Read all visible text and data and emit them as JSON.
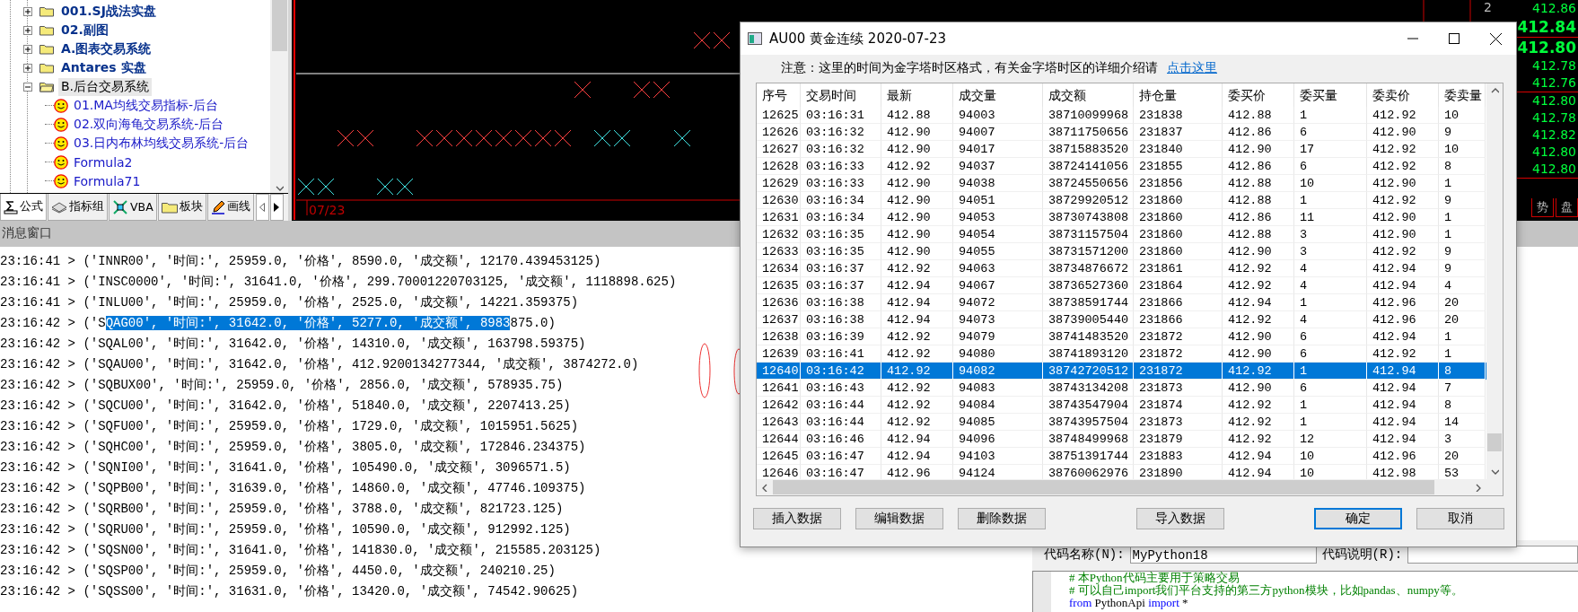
{
  "tree": {
    "items": [
      {
        "label": "001.SJ战法实盘",
        "kind": "folder",
        "expanded": false,
        "selected": false
      },
      {
        "label": "02.副图",
        "kind": "folder",
        "expanded": false,
        "selected": false
      },
      {
        "label": "A.图表交易系统",
        "kind": "folder",
        "expanded": false,
        "selected": false
      },
      {
        "label": "Antares 实盘",
        "kind": "folder",
        "expanded": false,
        "selected": false
      },
      {
        "label": "B.后台交易系统",
        "kind": "folder",
        "expanded": true,
        "selected": true,
        "children": [
          {
            "label": "01.MA均线交易指标-后台",
            "kind": "formula",
            "selected": false
          },
          {
            "label": "02.双向海龟交易系统-后台",
            "kind": "formula",
            "selected": false
          },
          {
            "label": "03.日内布林均线交易系统-后台",
            "kind": "formula",
            "selected": false
          },
          {
            "label": "Formula2",
            "kind": "formula",
            "selected": false
          },
          {
            "label": "Formula71",
            "kind": "formula",
            "selected": false
          }
        ]
      }
    ]
  },
  "panel_tabs": [
    {
      "label": "公式",
      "kind": "formula",
      "selected": true
    },
    {
      "label": "指标组",
      "kind": "group",
      "selected": false
    },
    {
      "label": "VBA",
      "kind": "vba",
      "selected": false
    },
    {
      "label": "板块",
      "kind": "folder",
      "selected": false
    },
    {
      "label": "画线",
      "kind": "pen",
      "selected": false
    }
  ],
  "chart": {
    "date": "07/23",
    "corner_label": "2"
  },
  "ticker": {
    "groups": [
      {
        "prices": [
          {
            "text": "412.86",
            "emphasis": false
          },
          {
            "text": "412.84",
            "emphasis": true
          }
        ]
      },
      {
        "prices": [
          {
            "text": "412.80",
            "emphasis": true
          },
          {
            "text": "412.78",
            "emphasis": false
          },
          {
            "text": "412.76",
            "emphasis": false
          }
        ]
      },
      {
        "prices": [
          {
            "text": "412.80",
            "emphasis": false
          },
          {
            "text": "412.78",
            "emphasis": false
          },
          {
            "text": "412.82",
            "emphasis": false
          },
          {
            "text": "412.80",
            "emphasis": false
          },
          {
            "text": "412.80",
            "emphasis": false
          }
        ]
      }
    ],
    "tabs": [
      {
        "label": "势",
        "selected": false
      },
      {
        "label": "盘",
        "selected": false
      }
    ]
  },
  "message_window": {
    "title": "消息窗口",
    "lines": [
      {
        "parts": [
          {
            "text": "23:16:41 > ('INNR00', '时间:', 25959.0, '价格', 8590.0, '成交额', 12170.439453125)",
            "selected": false
          }
        ]
      },
      {
        "parts": [
          {
            "text": "23:16:41 > ('INSC0000', '时间:', 31641.0, '价格', 299.70001220703125, '成交额', 1118898.625)",
            "selected": false
          }
        ]
      },
      {
        "parts": [
          {
            "text": "23:16:41 > ('INLU00', '时间:', 25959.0, '价格', 2525.0, '成交额', 14221.359375)",
            "selected": false
          }
        ]
      },
      {
        "parts": [
          {
            "text": "23:16:42 > ('S",
            "selected": false
          },
          {
            "text": "QAG00', '时间:', 31642.0, '价格', 5277.0, '成交额', 8983",
            "selected": true
          },
          {
            "text": "875.0)",
            "selected": false
          }
        ]
      },
      {
        "parts": [
          {
            "text": "23:16:42 > ('SQAL00', '时间:', 31642.0, '价格', 14310.0, '成交额', 163798.59375)",
            "selected": false
          }
        ]
      },
      {
        "parts": [
          {
            "text": "23:16:42 > ('SQAU00', '时间:', 31642.0, '价格', 412.9200134277344, '成交额', 3874272.0)",
            "selected": false
          }
        ]
      },
      {
        "parts": [
          {
            "text": "23:16:42 > ('SQBUX00', '时间:', 25959.0, '价格', 2856.0, '成交额', 578935.75)",
            "selected": false
          }
        ]
      },
      {
        "parts": [
          {
            "text": "23:16:42 > ('SQCU00', '时间:', 31642.0, '价格', 51840.0, '成交额', 2207413.25)",
            "selected": false
          }
        ]
      },
      {
        "parts": [
          {
            "text": "23:16:42 > ('SQFU00', '时间:', 25959.0, '价格', 1729.0, '成交额', 1015951.5625)",
            "selected": false
          }
        ]
      },
      {
        "parts": [
          {
            "text": "23:16:42 > ('SQHC00', '时间:', 25959.0, '价格', 3805.0, '成交额', 172846.234375)",
            "selected": false
          }
        ]
      },
      {
        "parts": [
          {
            "text": "23:16:42 > ('SQNI00', '时间:', 31641.0, '价格', 105490.0, '成交额', 3096571.5)",
            "selected": false
          }
        ]
      },
      {
        "parts": [
          {
            "text": "23:16:42 > ('SQPB00', '时间:', 31639.0, '价格', 14860.0, '成交额', 47746.109375)",
            "selected": false
          }
        ]
      },
      {
        "parts": [
          {
            "text": "23:16:42 > ('SQRB00', '时间:', 25959.0, '价格', 3788.0, '成交额', 821723.125)",
            "selected": false
          }
        ]
      },
      {
        "parts": [
          {
            "text": "23:16:42 > ('SQRU00', '时间:', 25959.0, '价格', 10590.0, '成交额', 912992.125)",
            "selected": false
          }
        ]
      },
      {
        "parts": [
          {
            "text": "23:16:42 > ('SQSN00', '时间:', 31641.0, '价格', 141830.0, '成交额', 215585.203125)",
            "selected": false
          }
        ]
      },
      {
        "parts": [
          {
            "text": "23:16:42 > ('SQSP00', '时间:', 25959.0, '价格', 4450.0, '成交额', 240210.25)",
            "selected": false
          }
        ]
      },
      {
        "parts": [
          {
            "text": "23:16:42 > ('SQSS00', '时间:', 31631.0, '价格', 13420.0, '成交额', 74542.90625)",
            "selected": false
          }
        ]
      }
    ]
  },
  "code_panel": {
    "name_label": "代码名称(N):",
    "name_value": "MyPython18",
    "desc_label": "代码说明(R):",
    "lines": [
      {
        "tokens": [
          {
            "text": "# 本Python代码主要用于策略交易",
            "kind": "comment"
          }
        ]
      },
      {
        "tokens": [
          {
            "text": "# 可以自己import我们平台支持的第三方python模块，比如pandas、numpy等。",
            "kind": "comment"
          }
        ]
      },
      {
        "tokens": [
          {
            "text": "from",
            "kind": "keyword"
          },
          {
            "text": " PythonApi ",
            "kind": "plain"
          },
          {
            "text": "import",
            "kind": "keyword"
          },
          {
            "text": " *",
            "kind": "plain"
          }
        ]
      }
    ]
  },
  "dialog": {
    "title": "AU00 黄金连续 2020-07-23",
    "note": "注意：这里的时间为金字塔时区格式，有关金字塔时区的详细介绍请",
    "note_link": "点击这里",
    "table": {
      "columns": [
        "序号",
        "交易时间",
        "最新",
        "成交量",
        "成交额",
        "持仓量",
        "委买价",
        "委买量",
        "委卖价",
        "委卖量"
      ],
      "rows": [
        {
          "cells": [
            "12625",
            "03:16:31",
            "412.88",
            "94003",
            "38710099968",
            "231838",
            "412.88",
            "1",
            "412.92",
            "10"
          ],
          "selected": false
        },
        {
          "cells": [
            "12626",
            "03:16:32",
            "412.90",
            "94007",
            "38711750656",
            "231837",
            "412.86",
            "6",
            "412.90",
            "9"
          ],
          "selected": false
        },
        {
          "cells": [
            "12627",
            "03:16:32",
            "412.90",
            "94017",
            "38715883520",
            "231840",
            "412.90",
            "17",
            "412.92",
            "10"
          ],
          "selected": false
        },
        {
          "cells": [
            "12628",
            "03:16:33",
            "412.92",
            "94037",
            "38724141056",
            "231855",
            "412.86",
            "6",
            "412.92",
            "8"
          ],
          "selected": false
        },
        {
          "cells": [
            "12629",
            "03:16:33",
            "412.90",
            "94038",
            "38724550656",
            "231856",
            "412.88",
            "10",
            "412.90",
            "1"
          ],
          "selected": false
        },
        {
          "cells": [
            "12630",
            "03:16:34",
            "412.90",
            "94051",
            "38729920512",
            "231860",
            "412.88",
            "1",
            "412.92",
            "9"
          ],
          "selected": false
        },
        {
          "cells": [
            "12631",
            "03:16:34",
            "412.90",
            "94053",
            "38730743808",
            "231860",
            "412.86",
            "11",
            "412.90",
            "1"
          ],
          "selected": false
        },
        {
          "cells": [
            "12632",
            "03:16:35",
            "412.90",
            "94054",
            "38731157504",
            "231860",
            "412.88",
            "3",
            "412.90",
            "1"
          ],
          "selected": false
        },
        {
          "cells": [
            "12633",
            "03:16:35",
            "412.90",
            "94055",
            "38731571200",
            "231860",
            "412.90",
            "3",
            "412.92",
            "9"
          ],
          "selected": false
        },
        {
          "cells": [
            "12634",
            "03:16:37",
            "412.92",
            "94063",
            "38734876672",
            "231861",
            "412.92",
            "4",
            "412.94",
            "9"
          ],
          "selected": false
        },
        {
          "cells": [
            "12635",
            "03:16:37",
            "412.94",
            "94067",
            "38736527360",
            "231864",
            "412.92",
            "4",
            "412.94",
            "4"
          ],
          "selected": false
        },
        {
          "cells": [
            "12636",
            "03:16:38",
            "412.94",
            "94072",
            "38738591744",
            "231866",
            "412.94",
            "1",
            "412.96",
            "20"
          ],
          "selected": false
        },
        {
          "cells": [
            "12637",
            "03:16:38",
            "412.94",
            "94073",
            "38739005440",
            "231866",
            "412.92",
            "4",
            "412.96",
            "20"
          ],
          "selected": false
        },
        {
          "cells": [
            "12638",
            "03:16:39",
            "412.92",
            "94079",
            "38741483520",
            "231872",
            "412.90",
            "6",
            "412.94",
            "1"
          ],
          "selected": false
        },
        {
          "cells": [
            "12639",
            "03:16:41",
            "412.92",
            "94080",
            "38741893120",
            "231872",
            "412.90",
            "6",
            "412.92",
            "1"
          ],
          "selected": false
        },
        {
          "cells": [
            "12640",
            "03:16:42",
            "412.92",
            "94082",
            "38742720512",
            "231872",
            "412.92",
            "1",
            "412.94",
            "8"
          ],
          "selected": true
        },
        {
          "cells": [
            "12641",
            "03:16:43",
            "412.92",
            "94083",
            "38743134208",
            "231873",
            "412.90",
            "6",
            "412.94",
            "7"
          ],
          "selected": false
        },
        {
          "cells": [
            "12642",
            "03:16:44",
            "412.92",
            "94084",
            "38743547904",
            "231874",
            "412.92",
            "1",
            "412.94",
            "8"
          ],
          "selected": false
        },
        {
          "cells": [
            "12643",
            "03:16:44",
            "412.92",
            "94085",
            "38743957504",
            "231873",
            "412.92",
            "1",
            "412.94",
            "14"
          ],
          "selected": false
        },
        {
          "cells": [
            "12644",
            "03:16:46",
            "412.94",
            "94096",
            "38748499968",
            "231879",
            "412.92",
            "12",
            "412.94",
            "3"
          ],
          "selected": false
        },
        {
          "cells": [
            "12645",
            "03:16:47",
            "412.94",
            "94103",
            "38751391744",
            "231883",
            "412.94",
            "10",
            "412.96",
            "20"
          ],
          "selected": false
        },
        {
          "cells": [
            "12646",
            "03:16:47",
            "412.96",
            "94124",
            "38760062976",
            "231890",
            "412.94",
            "10",
            "412.98",
            "53"
          ],
          "selected": false
        }
      ]
    },
    "button_groups": [
      [
        {
          "label": "插入数据",
          "default": false
        },
        {
          "label": "编辑数据",
          "default": false
        },
        {
          "label": "删除数据",
          "default": false
        }
      ],
      [
        {
          "label": "导入数据",
          "default": false
        }
      ],
      [
        {
          "label": "确定",
          "default": true
        },
        {
          "label": "取消",
          "default": false
        }
      ]
    ]
  }
}
